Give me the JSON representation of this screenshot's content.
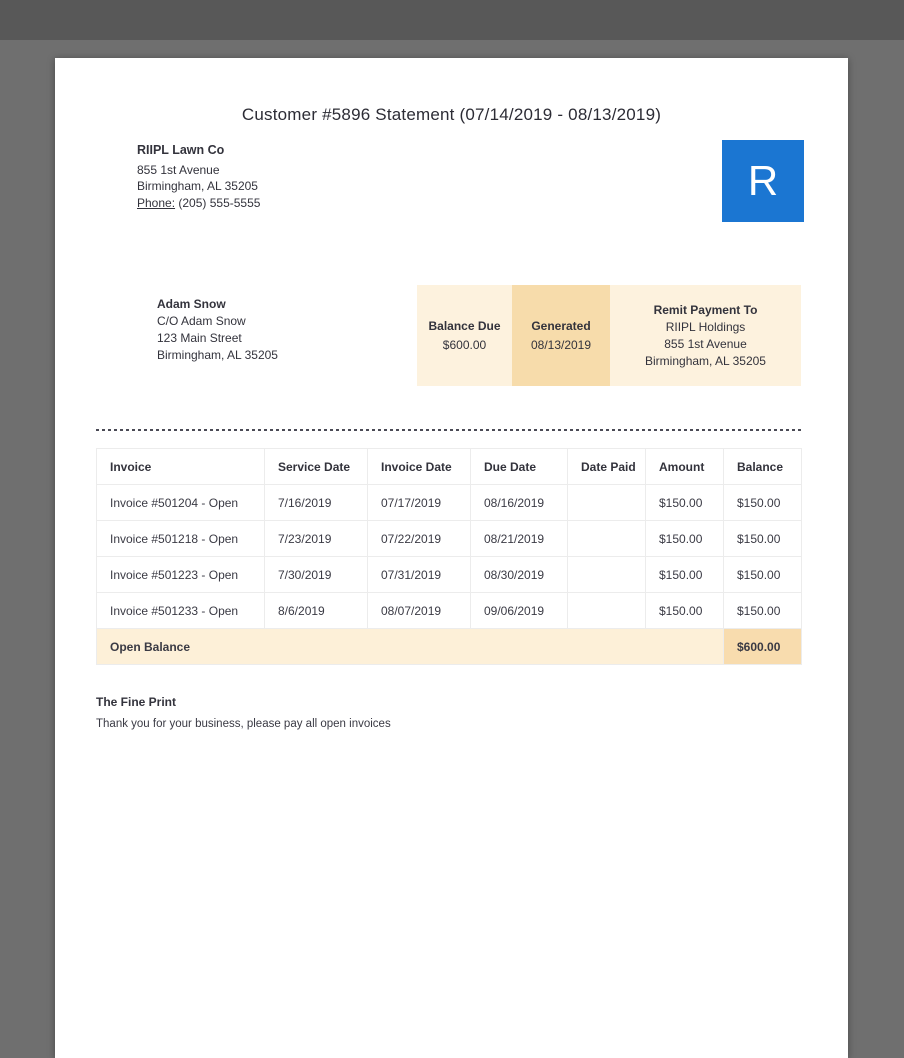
{
  "statement": {
    "title": "Customer #5896 Statement (07/14/2019 - 08/13/2019)"
  },
  "company": {
    "name": "RIIPL Lawn Co",
    "address_line1": "855 1st Avenue",
    "address_line2": "Birmingham, AL 35205",
    "phone_label": "Phone:",
    "phone_value": "(205) 555-5555",
    "logo_letter": "R"
  },
  "customer": {
    "name": "Adam Snow",
    "line1": "C/O Adam Snow",
    "line2": "123 Main Street",
    "line3": "Birmingham, AL 35205"
  },
  "summary": {
    "balance_due_label": "Balance Due",
    "balance_due_value": "$600.00",
    "generated_label": "Generated",
    "generated_value": "08/13/2019",
    "remit_label": "Remit Payment To",
    "remit_name": "RIIPL Holdings",
    "remit_address1": "855 1st Avenue",
    "remit_address2": "Birmingham, AL 35205"
  },
  "invoice_table": {
    "headers": [
      "Invoice",
      "Service Date",
      "Invoice Date",
      "Due Date",
      "Date Paid",
      "Amount",
      "Balance"
    ],
    "rows": [
      [
        "Invoice #501204 - Open",
        "7/16/2019",
        "07/17/2019",
        "08/16/2019",
        "",
        "$150.00",
        "$150.00"
      ],
      [
        "Invoice #501218 - Open",
        "7/23/2019",
        "07/22/2019",
        "08/21/2019",
        "",
        "$150.00",
        "$150.00"
      ],
      [
        "Invoice #501223 - Open",
        "7/30/2019",
        "07/31/2019",
        "08/30/2019",
        "",
        "$150.00",
        "$150.00"
      ],
      [
        "Invoice #501233 - Open",
        "8/6/2019",
        "08/07/2019",
        "09/06/2019",
        "",
        "$150.00",
        "$150.00"
      ]
    ],
    "footer": {
      "label": "Open Balance",
      "total": "$600.00"
    }
  },
  "fine_print": {
    "heading": "The Fine Print",
    "text": "Thank you for your business, please pay all open invoices"
  },
  "colors": {
    "brand_blue": "#1b76d2",
    "summary_light_bg": "#fdf2de",
    "summary_dark_bg": "#f7dcab",
    "total_row_bg": "#fdf0d8",
    "total_cell_bg": "#f8dcae"
  }
}
